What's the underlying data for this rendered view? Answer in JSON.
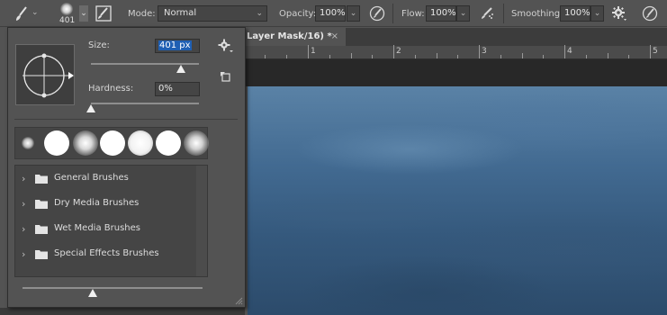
{
  "options_bar": {
    "brush_size_value": "401",
    "mode_label": "Mode:",
    "mode_value": "Normal",
    "opacity_label": "Opacity:",
    "opacity_value": "100%",
    "flow_label": "Flow:",
    "flow_value": "100%",
    "smoothing_label": "Smoothing:",
    "smoothing_value": "100%"
  },
  "document": {
    "tab_title": "Layer Mask/16) *",
    "close_glyph": "×",
    "ruler_marks": [
      "1",
      "2",
      "3",
      "4",
      "5"
    ]
  },
  "brush_picker": {
    "size_label": "Size:",
    "size_value": "401 px",
    "size_fraction": 0.83,
    "hardness_label": "Hardness:",
    "hardness_value": "0%",
    "hardness_fraction": 0.0,
    "preview_slider_fraction": 0.39,
    "groups": [
      {
        "name": "General Brushes"
      },
      {
        "name": "Dry Media Brushes"
      },
      {
        "name": "Wet Media Brushes"
      },
      {
        "name": "Special Effects Brushes"
      }
    ]
  },
  "colors": {
    "panel": "#535353",
    "field": "#454545",
    "selection": "#1f5fb3",
    "sky_top": "#5a82a6",
    "sky_bottom": "#2c4b6b"
  }
}
